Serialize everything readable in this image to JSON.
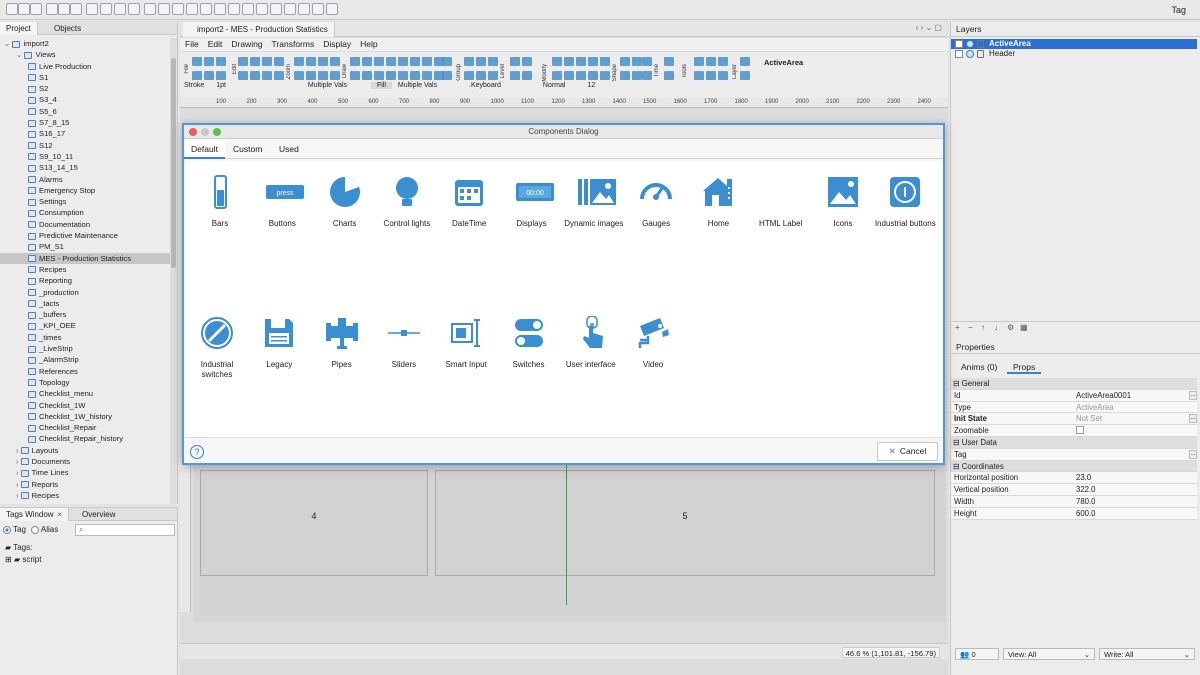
{
  "top_right_tag": "Tag",
  "left_tabs": {
    "project": "Project",
    "objects": "Objects"
  },
  "tree": [
    {
      "label": "import2",
      "indent": 0,
      "selected": false
    },
    {
      "label": "Views",
      "indent": 1,
      "selected": false
    },
    {
      "label": "Live Production",
      "indent": 2,
      "selected": false
    },
    {
      "label": "S1",
      "indent": 2,
      "selected": false
    },
    {
      "label": "S2",
      "indent": 2,
      "selected": false
    },
    {
      "label": "S3_4",
      "indent": 2,
      "selected": false
    },
    {
      "label": "S5_6",
      "indent": 2,
      "selected": false
    },
    {
      "label": "S7_8_15",
      "indent": 2,
      "selected": false
    },
    {
      "label": "S16_17",
      "indent": 2,
      "selected": false
    },
    {
      "label": "S12",
      "indent": 2,
      "selected": false
    },
    {
      "label": "S9_10_11",
      "indent": 2,
      "selected": false
    },
    {
      "label": "S13_14_15",
      "indent": 2,
      "selected": false
    },
    {
      "label": "Alarms",
      "indent": 2,
      "selected": false
    },
    {
      "label": "Emergency Stop",
      "indent": 2,
      "selected": false
    },
    {
      "label": "Settings",
      "indent": 2,
      "selected": false
    },
    {
      "label": "Consumption",
      "indent": 2,
      "selected": false
    },
    {
      "label": "Documentation",
      "indent": 2,
      "selected": false
    },
    {
      "label": "Predictive Maintenance",
      "indent": 2,
      "selected": false
    },
    {
      "label": "PM_S1",
      "indent": 2,
      "selected": false
    },
    {
      "label": "MES - Production Statistics",
      "indent": 2,
      "selected": true
    },
    {
      "label": "Recipes",
      "indent": 2,
      "selected": false
    },
    {
      "label": "Reporting",
      "indent": 2,
      "selected": false
    },
    {
      "label": "_production",
      "indent": 2,
      "selected": false
    },
    {
      "label": "_tacts",
      "indent": 2,
      "selected": false
    },
    {
      "label": "_buffers",
      "indent": 2,
      "selected": false
    },
    {
      "label": "_KPI_OEE",
      "indent": 2,
      "selected": false
    },
    {
      "label": "_times",
      "indent": 2,
      "selected": false
    },
    {
      "label": "_LiveStrip",
      "indent": 2,
      "selected": false
    },
    {
      "label": "_AlarmStrip",
      "indent": 2,
      "selected": false
    },
    {
      "label": "References",
      "indent": 2,
      "selected": false
    },
    {
      "label": "Topology",
      "indent": 2,
      "selected": false
    },
    {
      "label": "Checklist_menu",
      "indent": 2,
      "selected": false
    },
    {
      "label": "Checklist_1W",
      "indent": 2,
      "selected": false
    },
    {
      "label": "Checklist_1W_history",
      "indent": 2,
      "selected": false
    },
    {
      "label": "Checklist_Repair",
      "indent": 2,
      "selected": false
    },
    {
      "label": "Checklist_Repair_history",
      "indent": 2,
      "selected": false
    },
    {
      "label": "Layouts",
      "indent": 1,
      "selected": false
    },
    {
      "label": "Documents",
      "indent": 1,
      "selected": false
    },
    {
      "label": "Time Lines",
      "indent": 1,
      "selected": false
    },
    {
      "label": "Reports",
      "indent": 1,
      "selected": false
    },
    {
      "label": "Recipes",
      "indent": 1,
      "selected": false
    }
  ],
  "tags_window": {
    "tab": "Tags Window",
    "overview_tab": "Overview",
    "radio_tag": "Tag",
    "radio_alias": "Alias",
    "tree_root": "Tags:",
    "tree_child": "script"
  },
  "editor": {
    "doc_tab": "import2 - MES - Production Statistics",
    "menu": [
      "File",
      "Edit",
      "Drawing",
      "Transforms",
      "Display",
      "Help"
    ],
    "tool_groups": [
      "File",
      "Edit",
      "Zoom",
      "Draw",
      "Group",
      "Level",
      "Modify",
      "Shape",
      "Time",
      "Tools",
      "Layer"
    ],
    "active_area_label": "ActiveArea",
    "stroke": {
      "label": "Stroke",
      "width": "1pt",
      "multiple1": "Multiple Vals",
      "fill": "Fill",
      "multiple2": "Multiple Vals",
      "font": ".Keyboard",
      "style": "Normal",
      "size": "12"
    },
    "ruler_ticks": [
      "100",
      "200",
      "300",
      "400",
      "500",
      "600",
      "700",
      "800",
      "900",
      "1000",
      "1100",
      "1200",
      "1300",
      "1400",
      "1500",
      "1600",
      "1700",
      "1800",
      "1900",
      "2000",
      "2100",
      "2200",
      "2300",
      "2400",
      "2500"
    ],
    "areas": [
      "4",
      "5"
    ],
    "zoom_readout": "46.6 % (1,101.81, -156.79)"
  },
  "layers": {
    "title": "Layers",
    "items": [
      {
        "label": "ActiveArea",
        "selected": true
      },
      {
        "label": "Header",
        "selected": false
      }
    ]
  },
  "properties": {
    "title": "Properties",
    "tabs": [
      "Anims (0)",
      "Props"
    ],
    "rows": [
      {
        "type": "section",
        "key": "General"
      },
      {
        "type": "row",
        "key": "Id",
        "value": "ActiveArea0001",
        "dots": true
      },
      {
        "type": "row",
        "key": "Type",
        "value": "ActiveArea",
        "gray": true
      },
      {
        "type": "row",
        "key": "Init State",
        "value": "Not Set",
        "gray": true,
        "bold": true,
        "dots": true
      },
      {
        "type": "row",
        "key": "Zoomable",
        "value": "",
        "checkbox": true
      },
      {
        "type": "section",
        "key": "User Data"
      },
      {
        "type": "row",
        "key": "Tag",
        "value": "",
        "dots": true
      },
      {
        "type": "section",
        "key": "Coordinates"
      },
      {
        "type": "row",
        "key": "Horizontal position",
        "value": "23.0"
      },
      {
        "type": "row",
        "key": "Vertical position",
        "value": "322.0"
      },
      {
        "type": "row",
        "key": "Width",
        "value": "780.0"
      },
      {
        "type": "row",
        "key": "Height",
        "value": "600.0"
      }
    ],
    "bottom": {
      "count": "0",
      "view": "View: All",
      "write": "Write: All"
    }
  },
  "dialog": {
    "title": "Components Dialog",
    "tabs": [
      "Default",
      "Custom",
      "Used"
    ],
    "components": [
      {
        "label": "Bars",
        "icon": "bars-icon"
      },
      {
        "label": "Buttons",
        "icon": "buttons-icon",
        "button_text": "press"
      },
      {
        "label": "Charts",
        "icon": "charts-icon"
      },
      {
        "label": "Control lights",
        "icon": "control-lights-icon"
      },
      {
        "label": "DateTime",
        "icon": "datetime-icon"
      },
      {
        "label": "Displays",
        "icon": "displays-icon",
        "display_text": "00:00"
      },
      {
        "label": "Dynamic images",
        "icon": "dynamic-images-icon"
      },
      {
        "label": "Gauges",
        "icon": "gauges-icon"
      },
      {
        "label": "Home",
        "icon": "home-icon"
      },
      {
        "label": "HTML Label",
        "icon": "html-label-icon",
        "glyph": "</>"
      },
      {
        "label": "Icons",
        "icon": "icons-icon"
      },
      {
        "label": "Industrial buttons",
        "icon": "industrial-buttons-icon"
      },
      {
        "label": "Industrial switches",
        "icon": "industrial-switches-icon"
      },
      {
        "label": "Legacy",
        "icon": "legacy-icon"
      },
      {
        "label": "Pipes",
        "icon": "pipes-icon"
      },
      {
        "label": "Sliders",
        "icon": "sliders-icon"
      },
      {
        "label": "Smart Input",
        "icon": "smart-input-icon"
      },
      {
        "label": "Switches",
        "icon": "switches-icon"
      },
      {
        "label": "User interface",
        "icon": "user-interface-icon"
      },
      {
        "label": "Video",
        "icon": "video-icon"
      }
    ],
    "cancel_label": "Cancel",
    "accent": "#3b8ed0"
  }
}
